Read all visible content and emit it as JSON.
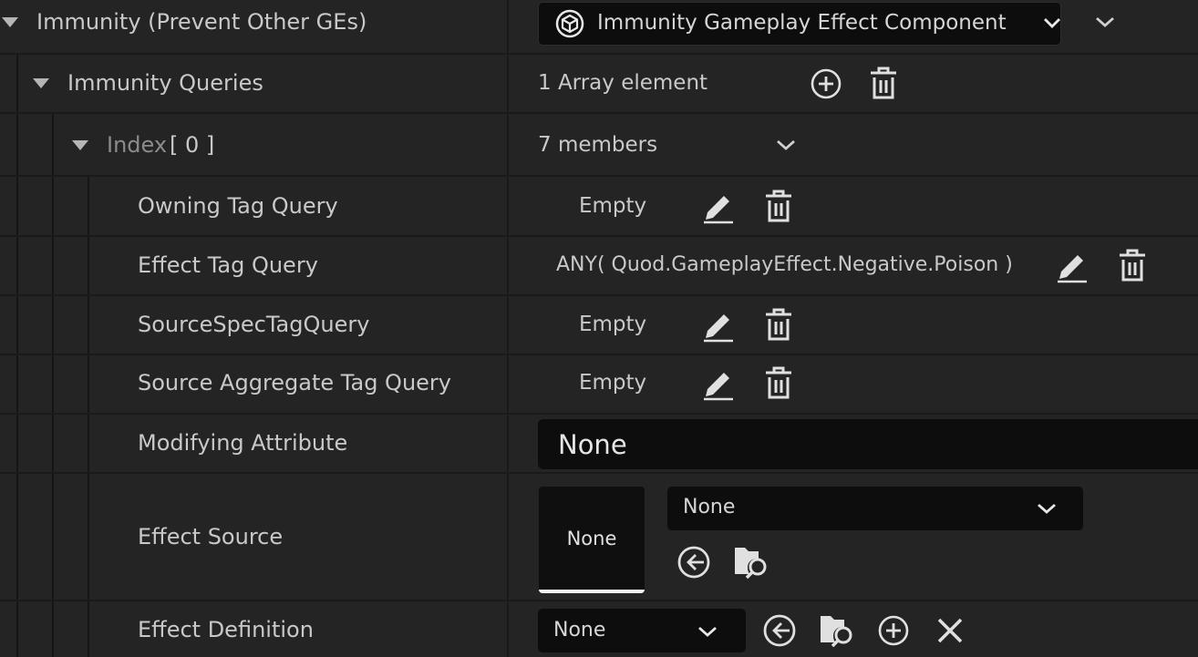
{
  "component": {
    "section_label": "Immunity (Prevent Other GEs)",
    "dropdown_label": "Immunity Gameplay Effect Component",
    "icon": "cube-icon"
  },
  "queries": {
    "label": "Immunity Queries",
    "count_text": "1 Array element"
  },
  "index": {
    "label": "Index",
    "bracket": "[ 0 ]",
    "members_text": "7 members"
  },
  "properties": {
    "owning_tag_query": {
      "label": "Owning Tag Query",
      "value": "Empty"
    },
    "effect_tag_query": {
      "label": "Effect Tag Query",
      "value": "ANY( Quod.GameplayEffect.Negative.Poison )"
    },
    "source_spec_tag_query": {
      "label": "SourceSpecTagQuery",
      "value": "Empty"
    },
    "source_aggregate_tag_query": {
      "label": "Source Aggregate Tag Query",
      "value": "Empty"
    },
    "modifying_attribute": {
      "label": "Modifying Attribute",
      "value": "None"
    },
    "effect_source": {
      "label": "Effect Source",
      "thumbnail": "None",
      "selected": "None"
    },
    "effect_definition": {
      "label": "Effect Definition",
      "selected": "None"
    }
  },
  "colors": {
    "row_bg": "#242424",
    "gap": "#151515",
    "field_bg": "#0d0d0d",
    "text": "#c9c9c9"
  }
}
